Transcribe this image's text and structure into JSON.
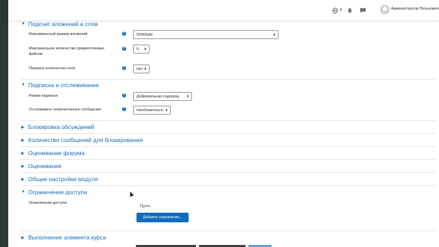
{
  "header": {
    "user_name": "Администратор Пользователь"
  },
  "sections": {
    "attachments": {
      "title": "Подсчет вложений и слов",
      "max_size_label": "Максимальный размер вложений",
      "max_size_value": "500Кбайт",
      "max_files_label": "Максимальное количество прикрепляемых файлов",
      "max_files_value": "9",
      "show_words_label": "Показать количество слов",
      "show_words_value": "Нет"
    },
    "subscription": {
      "title": "Подписка и отслеживание",
      "mode_label": "Режим подписки",
      "mode_value": "Добровольная подписка",
      "track_label": "Отслеживать непрочитанные сообщения",
      "track_value": "Необязательно"
    },
    "collapsed": [
      "Блокировка обсуждений",
      "Количество сообщений для блокирования",
      "Оценивание форума",
      "Оценивание",
      "Общие настройки модуля"
    ],
    "restrict": {
      "title": "Ограничение доступа",
      "label": "Ограничения доступа",
      "value": "Пусто",
      "add_button": "Добавить ограничение..."
    },
    "completion": {
      "title": "Выполнение элемента курса"
    }
  }
}
